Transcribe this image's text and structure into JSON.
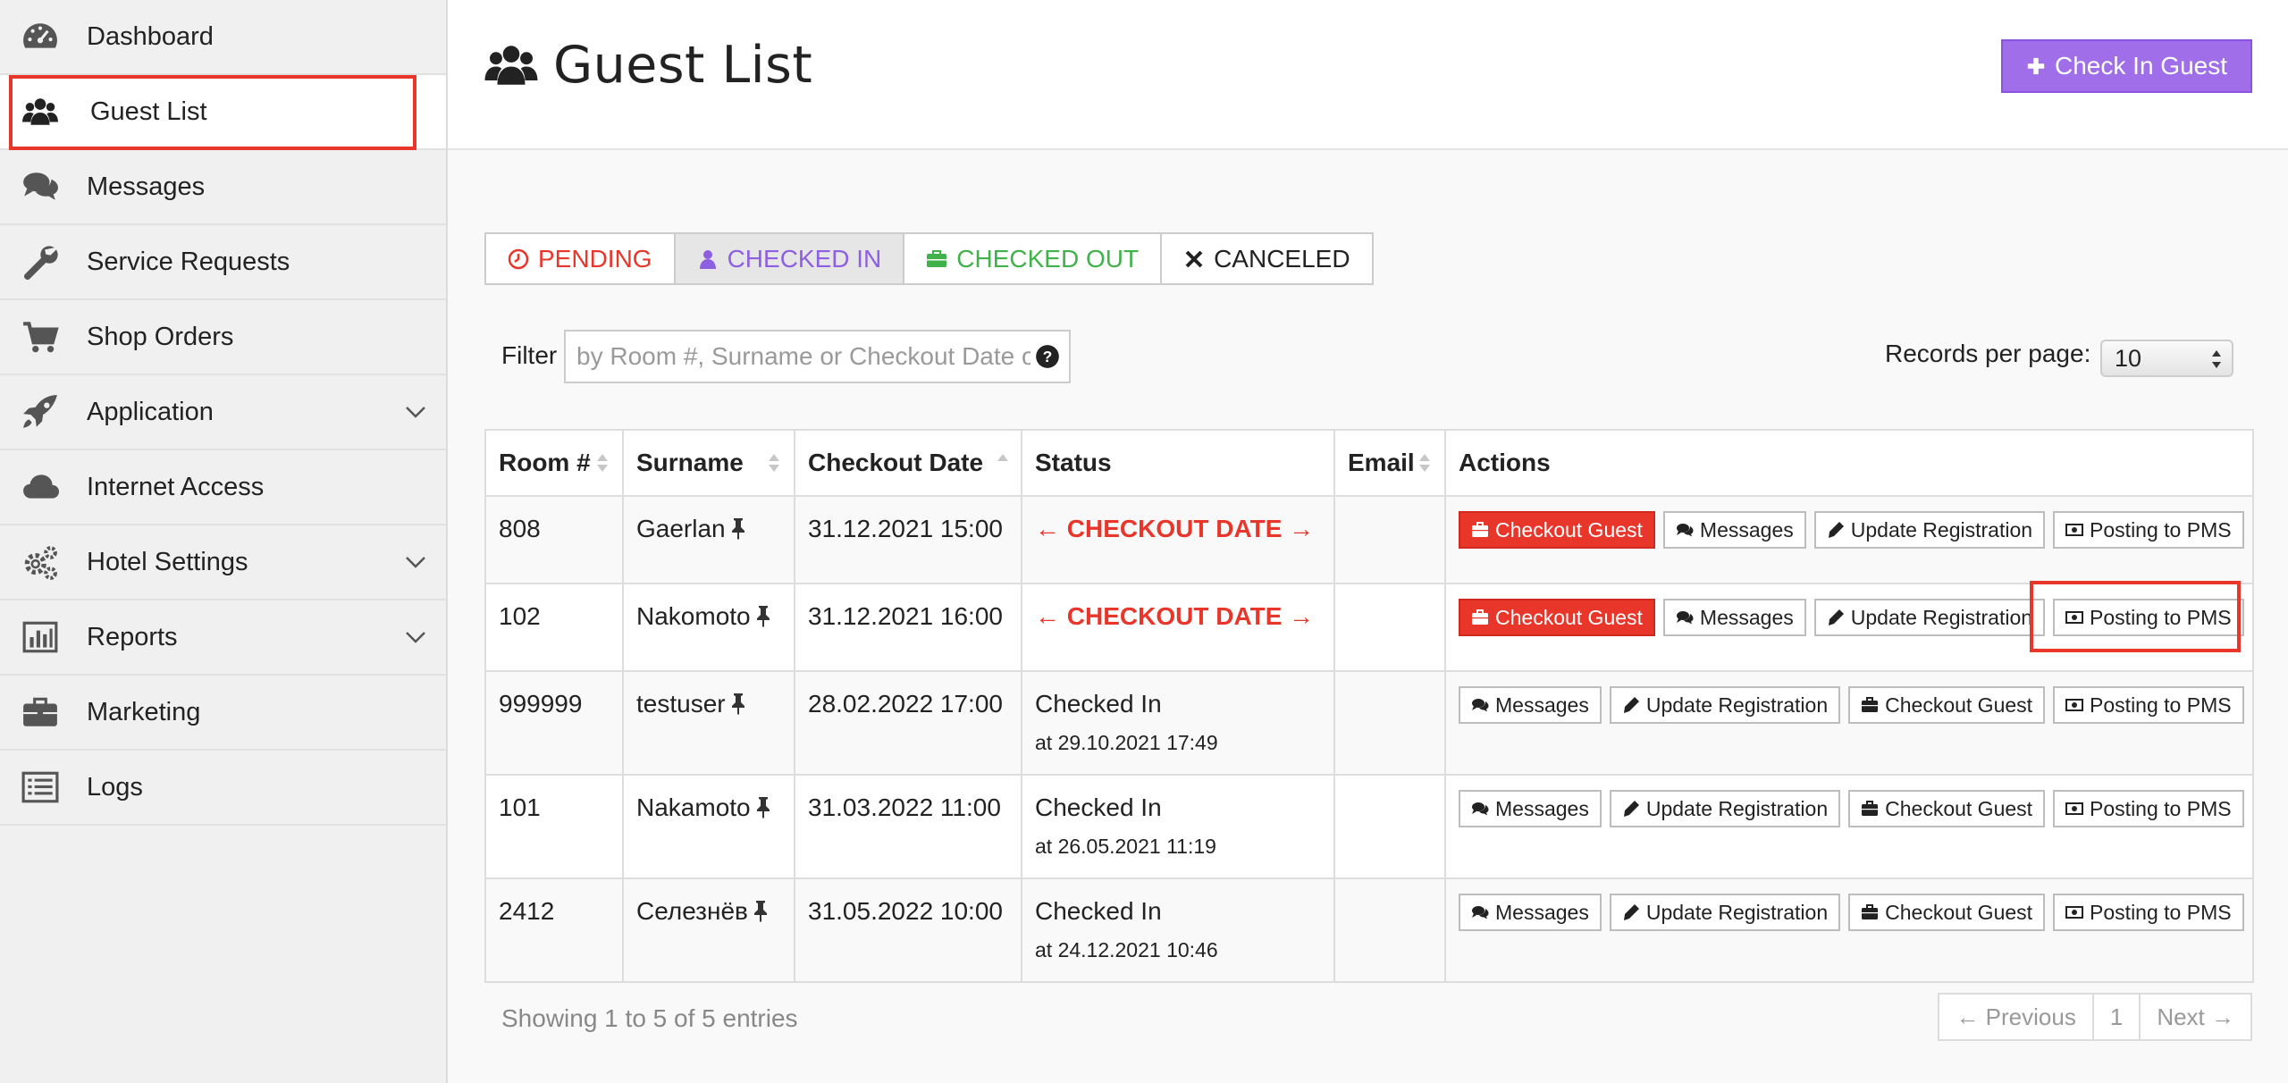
{
  "sidebar": {
    "items": [
      {
        "label": "Dashboard",
        "icon": "dashboard-icon"
      },
      {
        "label": "Guest List",
        "icon": "users-icon"
      },
      {
        "label": "Messages",
        "icon": "comments-icon"
      },
      {
        "label": "Service Requests",
        "icon": "wrench-icon"
      },
      {
        "label": "Shop Orders",
        "icon": "cart-icon"
      },
      {
        "label": "Application",
        "icon": "rocket-icon"
      },
      {
        "label": "Internet Access",
        "icon": "cloud-icon"
      },
      {
        "label": "Hotel Settings",
        "icon": "gears-icon"
      },
      {
        "label": "Reports",
        "icon": "bar-chart-icon"
      },
      {
        "label": "Marketing",
        "icon": "briefcase-icon"
      },
      {
        "label": "Logs",
        "icon": "list-icon"
      }
    ]
  },
  "header": {
    "title": "Guest List",
    "checkin_label": "Check In Guest"
  },
  "tabs": {
    "pending": "PENDING",
    "checked_in": "CHECKED IN",
    "checked_out": "CHECKED OUT",
    "canceled": "CANCELED"
  },
  "filter": {
    "label": "Filter",
    "placeholder": "by Room #, Surname or Checkout Date or Status"
  },
  "records": {
    "label": "Records per page:",
    "value": "10"
  },
  "table": {
    "headers": [
      "Room #",
      "Surname",
      "Checkout Date",
      "Status",
      "Email",
      "Actions"
    ],
    "rows": [
      {
        "room": "808",
        "surname": "Gaerlan",
        "checkout": "31.12.2021 15:00",
        "status": "← CHECKOUT DATE →",
        "status_sub": "",
        "email": ""
      },
      {
        "room": "102",
        "surname": "Nakomoto",
        "checkout": "31.12.2021 16:00",
        "status": "← CHECKOUT DATE →",
        "status_sub": "",
        "email": ""
      },
      {
        "room": "999999",
        "surname": "testuser",
        "checkout": "28.02.2022 17:00",
        "status": "Checked In",
        "status_sub": "at 29.10.2021 17:49",
        "email": ""
      },
      {
        "room": "101",
        "surname": "Nakamoto",
        "checkout": "31.03.2022 11:00",
        "status": "Checked In",
        "status_sub": "at 26.05.2021 11:19",
        "email": ""
      },
      {
        "room": "2412",
        "surname": "Селезнёв",
        "checkout": "31.05.2022 10:00",
        "status": "Checked In",
        "status_sub": "at 24.12.2021 10:46",
        "email": ""
      }
    ],
    "action_labels": {
      "checkout": "Checkout Guest",
      "messages": "Messages",
      "update": "Update Registration",
      "posting": "Posting to PMS"
    }
  },
  "footer": {
    "showing": "Showing 1 to 5 of 5 entries",
    "previous": "← Previous",
    "page": "1",
    "next": "Next →"
  },
  "colors": {
    "accent_purple": "#a06ee8",
    "danger_red": "#e8362b",
    "success_green": "#3fb24a"
  }
}
